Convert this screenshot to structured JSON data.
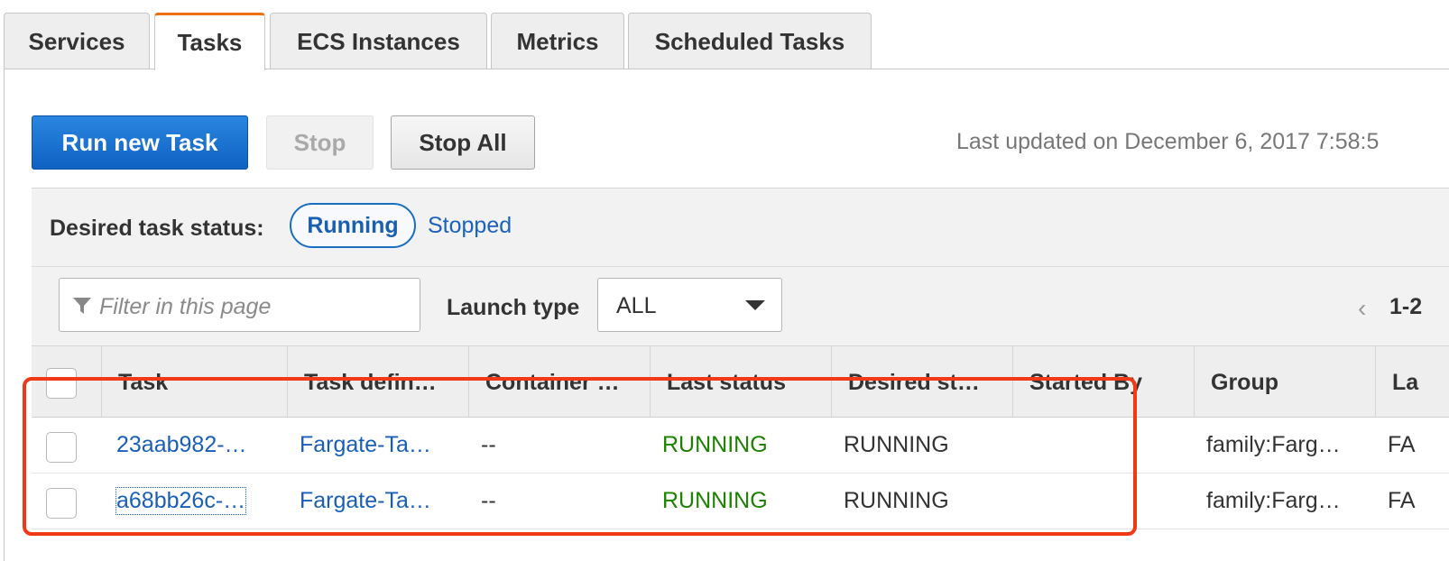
{
  "tabs": [
    {
      "label": "Services",
      "active": false
    },
    {
      "label": "Tasks",
      "active": true
    },
    {
      "label": "ECS Instances",
      "active": false
    },
    {
      "label": "Metrics",
      "active": false
    },
    {
      "label": "Scheduled Tasks",
      "active": false
    }
  ],
  "toolbar": {
    "run_label": "Run new Task",
    "stop_label": "Stop",
    "stop_all_label": "Stop All",
    "last_updated": "Last updated on December 6, 2017 7:58:5"
  },
  "status_filter": {
    "label": "Desired task status:",
    "running": "Running",
    "stopped": "Stopped",
    "selected": "Running"
  },
  "filter": {
    "placeholder": "Filter in this page",
    "launch_label": "Launch type",
    "launch_value": "ALL",
    "pager_prev": "‹",
    "pager_text": "1-2"
  },
  "table": {
    "columns": [
      "Task",
      "Task defin…",
      "Container …",
      "Last status",
      "Desired st…",
      "Started By",
      "Group",
      "La"
    ],
    "rows": [
      {
        "task": "23aab982-…",
        "task_def": "Fargate-Ta…",
        "container": "--",
        "last_status": "RUNNING",
        "desired": "RUNNING",
        "started_by": "",
        "group": "family:Farg…",
        "launch": "FA"
      },
      {
        "task": "a68bb26c-…",
        "task_def": "Fargate-Ta…",
        "container": "--",
        "last_status": "RUNNING",
        "desired": "RUNNING",
        "started_by": "",
        "group": "family:Farg…",
        "launch": "FA"
      }
    ]
  },
  "colors": {
    "accent_tab": "#ec7211",
    "primary_button": "#1a73d2",
    "link": "#1a5fb7",
    "running": "#1d8102",
    "highlight": "#f03a17"
  },
  "icons": {
    "filter": "filter-funnel-icon",
    "dropdown": "caret-down-icon",
    "pager_prev": "chevron-left-icon"
  }
}
